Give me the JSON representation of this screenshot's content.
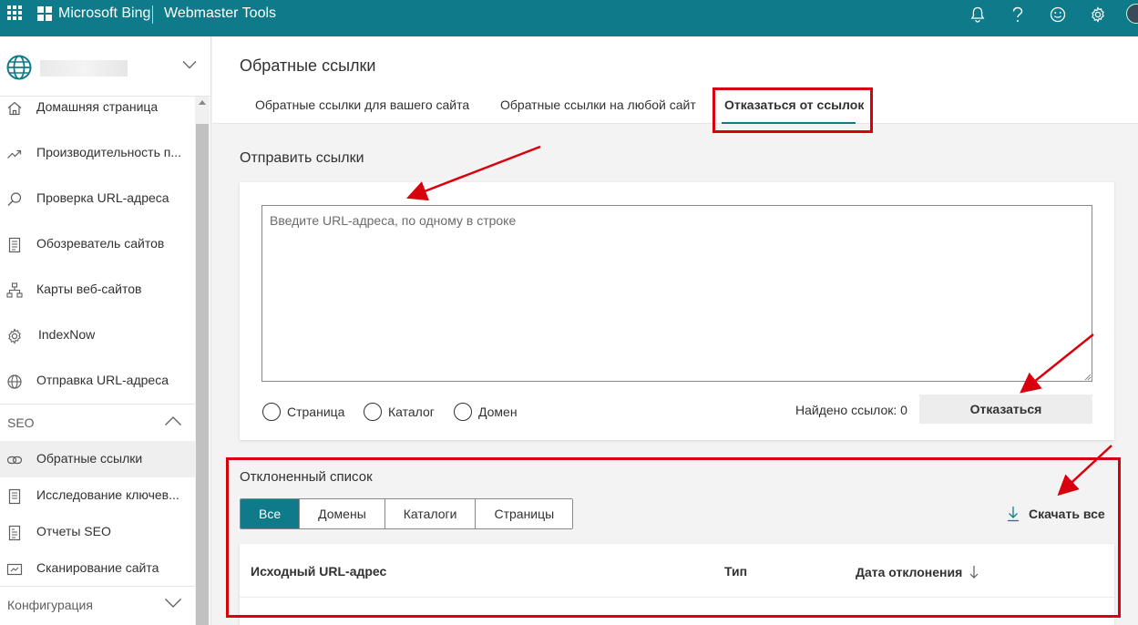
{
  "topbar": {
    "brand": "Microsoft Bing",
    "product": "Webmaster Tools",
    "icons": [
      "app-launcher-icon",
      "bell-icon",
      "help-icon",
      "smiley-icon",
      "gear-icon"
    ]
  },
  "sidebar": {
    "items": [
      {
        "label": "Домашняя страница",
        "icon": "home-icon"
      },
      {
        "label": "Производительность п...",
        "icon": "trend-icon"
      },
      {
        "label": "Проверка URL-адреса",
        "icon": "search-icon"
      },
      {
        "label": "Обозреватель сайтов",
        "icon": "list-icon"
      },
      {
        "label": "Карты веб-сайтов",
        "icon": "sitemap-icon"
      },
      {
        "label": "IndexNow",
        "icon": "settings-icon"
      },
      {
        "label": "Отправка URL-адреса",
        "icon": "globe-icon"
      }
    ],
    "seo_label": "SEO",
    "seo_items": [
      {
        "label": "Обратные ссылки",
        "icon": "link-icon"
      },
      {
        "label": "Исследование ключев...",
        "icon": "document-icon"
      },
      {
        "label": "Отчеты SEO",
        "icon": "report-icon"
      },
      {
        "label": "Сканирование сайта",
        "icon": "scan-icon"
      }
    ],
    "config_label": "Конфигурация"
  },
  "main": {
    "title": "Обратные ссылки",
    "tabs": [
      {
        "label": "Обратные ссылки для вашего сайта"
      },
      {
        "label": "Обратные ссылки на любой сайт"
      },
      {
        "label": "Отказаться от ссылок"
      }
    ],
    "submit": {
      "title": "Отправить ссылки",
      "placeholder": "Введите URL-адреса, по одному в строке",
      "radios": [
        "Страница",
        "Каталог",
        "Домен"
      ],
      "found": "Найдено ссылок: 0",
      "button": "Отказаться"
    },
    "rejected": {
      "title": "Отклоненный список",
      "filters": [
        "Все",
        "Домены",
        "Каталоги",
        "Страницы"
      ],
      "download": "Скачать все",
      "columns": [
        "Исходный URL-адрес",
        "Тип",
        "Дата отклонения"
      ]
    }
  },
  "colors": {
    "accent": "#0f7b8a",
    "highlight": "#d9000d"
  }
}
